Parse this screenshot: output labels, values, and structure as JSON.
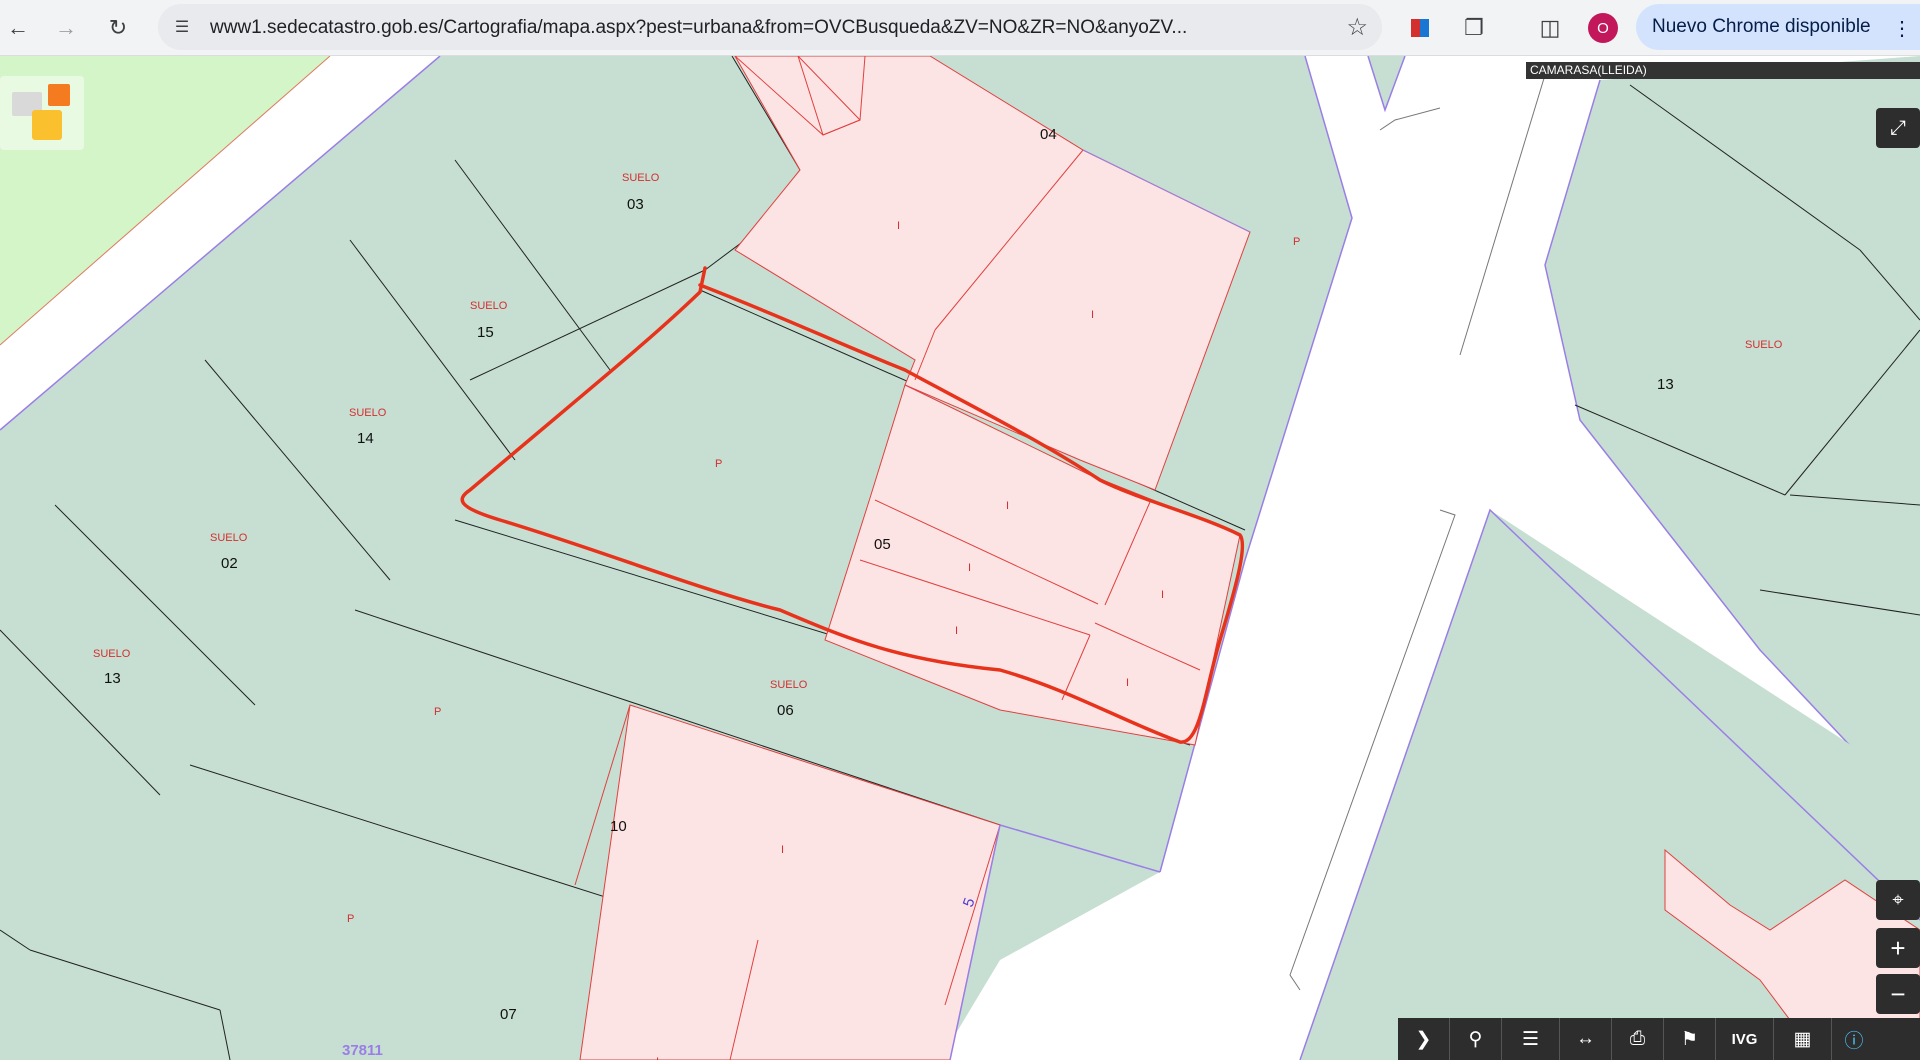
{
  "browser": {
    "url": "www1.sedecatastro.gob.es/Cartografia/mapa.aspx?pest=urbana&from=OVCBusqueda&ZV=NO&ZR=NO&anyoZV...",
    "profile_initial": "O",
    "update_label": "Nuevo Chrome disponible"
  },
  "map": {
    "municipality": "CAMARASA(LLEIDA)",
    "parcel_numbers": [
      "04",
      "03",
      "15",
      "14",
      "02",
      "13",
      "06",
      "05",
      "10",
      "07",
      "13"
    ],
    "suelo_label": "SUELO",
    "use_codes": {
      "industrial": "I",
      "plaza": "P"
    },
    "street_number": "5",
    "block_id": "37811",
    "colors": {
      "parcel_green": "#c6dfd2",
      "building_pink": "#fde4e4",
      "building_outline": "#e0403f",
      "boundary_purple": "#9a7ee6",
      "field_green": "#d3f5c7",
      "highlight_red": "#e8331c"
    }
  },
  "tools": [
    "next",
    "search",
    "layers",
    "measure",
    "print",
    "parcel",
    "ivg",
    "3d",
    "info"
  ],
  "zoom": {
    "locate": "locate-icon",
    "in": "+",
    "out": "−"
  }
}
